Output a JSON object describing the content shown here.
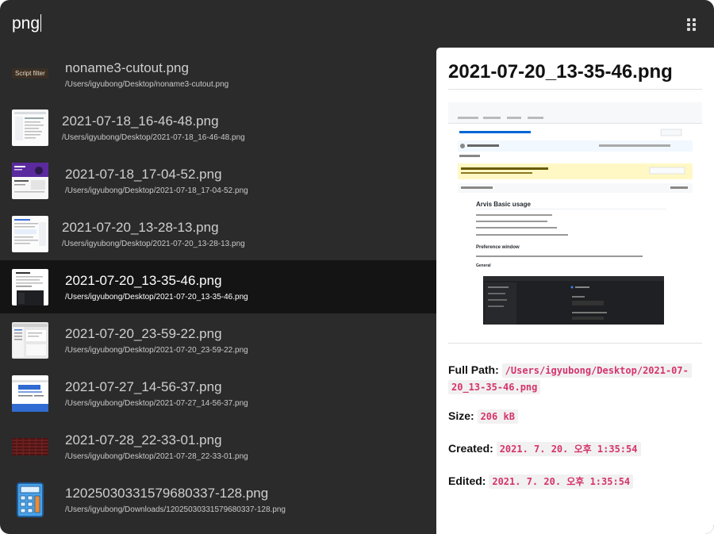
{
  "search": {
    "query": "png"
  },
  "badge": {
    "script_filter": "Script filter"
  },
  "results": [
    {
      "title": "noname3-cutout.png",
      "path": "/Users/igyubong/Desktop/noname3-cutout.png",
      "icon": "script-filter-badge"
    },
    {
      "title": "2021-07-18_16-46-48.png",
      "path": "/Users/igyubong/Desktop/2021-07-18_16-46-48.png",
      "icon": "document-thumbnail"
    },
    {
      "title": "2021-07-18_17-04-52.png",
      "path": "/Users/igyubong/Desktop/2021-07-18_17-04-52.png",
      "icon": "purple-web-thumbnail"
    },
    {
      "title": "2021-07-20_13-28-13.png",
      "path": "/Users/igyubong/Desktop/2021-07-20_13-28-13.png",
      "icon": "document-thumbnail"
    },
    {
      "title": "2021-07-20_13-35-46.png",
      "path": "/Users/igyubong/Desktop/2021-07-20_13-35-46.png",
      "icon": "dark-doc-thumbnail"
    },
    {
      "title": "2021-07-20_23-59-22.png",
      "path": "/Users/igyubong/Desktop/2021-07-20_23-59-22.png",
      "icon": "window-thumbnail"
    },
    {
      "title": "2021-07-27_14-56-37.png",
      "path": "/Users/igyubong/Desktop/2021-07-27_14-56-37.png",
      "icon": "blue-web-thumbnail"
    },
    {
      "title": "2021-07-28_22-33-01.png",
      "path": "/Users/igyubong/Desktop/2021-07-28_22-33-01.png",
      "icon": "red-grid-thumbnail"
    },
    {
      "title": "12025030331579680337-128.png",
      "path": "/Users/igyubong/Downloads/12025030331579680337-128.png",
      "icon": "calculator-icon"
    }
  ],
  "selected_index": 4,
  "preview": {
    "title": "2021-07-20_13-35-46.png",
    "full_path_label": "Full Path:",
    "full_path_line1": "/Users/igyubong/Desktop/2021-07-",
    "full_path_line2": "20_13-35-46.png",
    "size_label": "Size:",
    "size_value": "206 kB",
    "created_label": "Created:",
    "created_value": "2021. 7. 20. 오후 1:35:54",
    "edited_label": "Edited:",
    "edited_value": "2021. 7. 20. 오후 1:35:54"
  },
  "preview_image": {
    "heading": "Arvis Basic usage",
    "subheading": "Preference window",
    "section": "General"
  },
  "colors": {
    "window_bg": "#2b2b2b",
    "selected_row": "#141414",
    "code_text": "#d6336c"
  }
}
